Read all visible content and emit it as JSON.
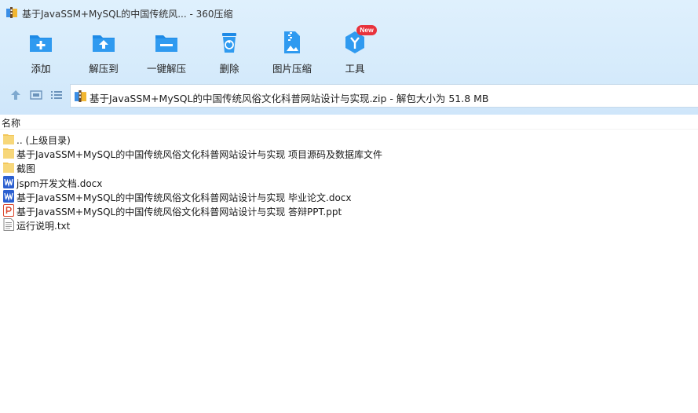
{
  "window": {
    "title": "基于JavaSSM+MySQL的中国传统风... - 360压缩"
  },
  "toolbar": {
    "items": [
      {
        "label": "添加",
        "icon": "add-folder-icon"
      },
      {
        "label": "解压到",
        "icon": "extract-to-icon"
      },
      {
        "label": "一键解压",
        "icon": "one-click-extract-icon"
      },
      {
        "label": "删除",
        "icon": "delete-icon"
      },
      {
        "label": "图片压缩",
        "icon": "image-compress-icon"
      },
      {
        "label": "工具",
        "icon": "tools-icon"
      }
    ],
    "new_badge": "New"
  },
  "nav": {
    "address": "基于JavaSSM+MySQL的中国传统风俗文化科普网站设计与实现.zip - 解包大小为 51.8 MB"
  },
  "list": {
    "column_name": "名称",
    "files": [
      {
        "name": ".. (上级目录)",
        "type": "folder"
      },
      {
        "name": "基于JavaSSM+MySQL的中国传统风俗文化科普网站设计与实现 项目源码及数据库文件",
        "type": "folder"
      },
      {
        "name": "截图",
        "type": "folder"
      },
      {
        "name": "jspm开发文档.docx",
        "type": "word"
      },
      {
        "name": "基于JavaSSM+MySQL的中国传统风俗文化科普网站设计与实现 毕业论文.docx",
        "type": "word"
      },
      {
        "name": "基于JavaSSM+MySQL的中国传统风俗文化科普网站设计与实现 答辩PPT.ppt",
        "type": "ppt"
      },
      {
        "name": "运行说明.txt",
        "type": "txt"
      }
    ]
  },
  "colors": {
    "accent_blue": "#1e8ae6",
    "toolbar_bg": "#d6ebfb",
    "badge_red": "#e8323c",
    "folder_yellow": "#f7d77a",
    "word_blue": "#2b5fd0",
    "ppt_red": "#d9442a"
  }
}
